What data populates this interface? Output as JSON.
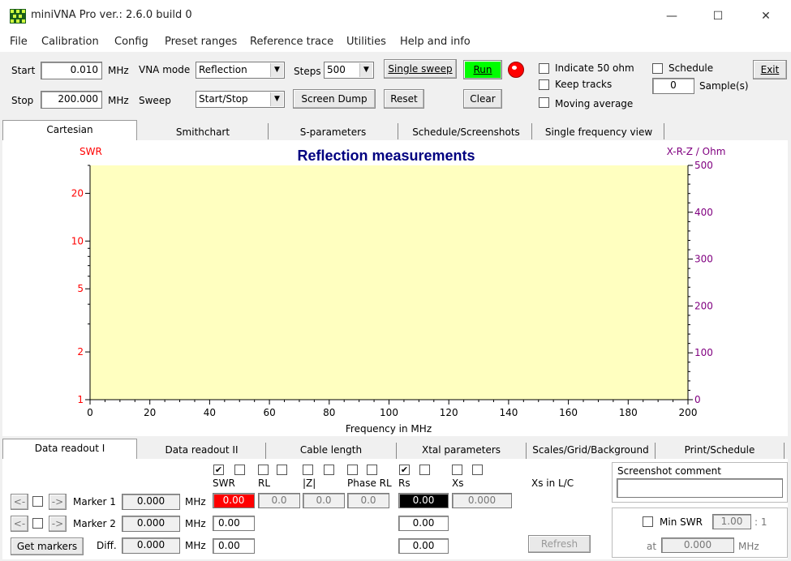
{
  "window": {
    "title": "miniVNA Pro ver.: 2.6.0 build 0",
    "minimize": "—",
    "maximize": "☐",
    "close": "✕"
  },
  "menu": [
    "File",
    "Calibration",
    "Config",
    "Preset ranges",
    "Reference trace",
    "Utilities",
    "Help and info"
  ],
  "controls": {
    "start_label": "Start",
    "start_value": "0.010",
    "start_unit": "MHz",
    "stop_label": "Stop",
    "stop_value": "200.000",
    "stop_unit": "MHz",
    "vna_mode_label": "VNA mode",
    "vna_mode_value": "Reflection",
    "sweep_label": "Sweep",
    "sweep_value": "Start/Stop",
    "steps_label": "Steps",
    "steps_value": "500",
    "single_sweep": "Single sweep",
    "run": "Run",
    "screen_dump": "Screen Dump",
    "reset": "Reset",
    "clear": "Clear",
    "indicate_50": "Indicate 50 ohm",
    "keep_tracks": "Keep tracks",
    "moving_average": "Moving average",
    "schedule": "Schedule",
    "samples_value": "0",
    "samples_label": "Sample(s)",
    "exit": "Exit",
    "run_color": "#00ff00",
    "status_led_color": "#ff0000"
  },
  "top_tabs": [
    "Cartesian",
    "Smithchart",
    "S-parameters",
    "Schedule/Screenshots",
    "Single frequency view"
  ],
  "chart_data": {
    "type": "line",
    "title": "Reflection measurements",
    "xlabel": "Frequency in MHz",
    "ylabel_left": "SWR",
    "ylabel_right": "X-R-Z / Ohm",
    "xlim": [
      0,
      200
    ],
    "x_ticks": [
      0,
      20,
      40,
      60,
      80,
      100,
      120,
      140,
      160,
      180,
      200
    ],
    "y_left_scale": "log",
    "y_left_ticks": [
      1,
      2,
      5,
      10,
      20
    ],
    "y_right_ticks": [
      0,
      100,
      200,
      300,
      400,
      500
    ],
    "series": [],
    "plot_background": "#ffffc0",
    "left_axis_color": "#ff0000",
    "right_axis_color": "#800080",
    "title_color": "#000080"
  },
  "bottom_tabs": [
    "Data readout I",
    "Data readout II",
    "Cable length",
    "Xtal parameters",
    "Scales/Grid/Background",
    "Print/Schedule"
  ],
  "readout": {
    "columns": [
      {
        "name": "SWR",
        "c1": "✔",
        "c2": ""
      },
      {
        "name": "RL",
        "c1": "",
        "c2": ""
      },
      {
        "name": "|Z|",
        "c1": "",
        "c2": ""
      },
      {
        "name": "Phase RL",
        "c1": "",
        "c2": ""
      },
      {
        "name": "Rs",
        "c1": "✔",
        "c2": ""
      },
      {
        "name": "Xs",
        "c1": "",
        "c2": ""
      }
    ],
    "xs_lc_label": "Xs in L/C",
    "prev": "<-",
    "next": "->",
    "marker1_label": "Marker 1",
    "marker1_value": "0.000",
    "marker2_label": "Marker 2",
    "marker2_value": "0.000",
    "get_markers": "Get markers",
    "diff_label": "Diff.",
    "diff_value": "0.000",
    "mhz": "MHz",
    "m1_swr": "0.00",
    "m1_rl": "0.0",
    "m1_z": "0.0",
    "m1_phase": "0.0",
    "m1_rs": "0.00",
    "m1_xs": "0.000",
    "m2_swr": "0.00",
    "m2_rs": "0.00",
    "diff_swr": "0.00",
    "diff_rs": "0.00",
    "refresh": "Refresh",
    "screenshot_comment": "Screenshot  comment",
    "min_swr_label": "Min SWR",
    "min_swr_value": "1.00",
    "min_swr_suffix": ": 1",
    "at_label": "at",
    "at_value": "0.000",
    "at_unit": "MHz",
    "swr_bg": "#ff0000",
    "rs_bg": "#000000"
  }
}
